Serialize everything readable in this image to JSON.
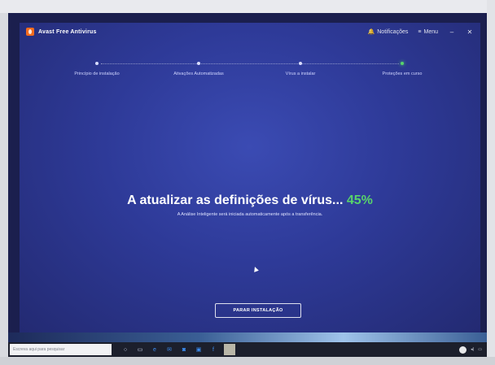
{
  "app": {
    "title": "Avast Free Antivirus",
    "notifications_label": "Notificações",
    "menu_label": "Menu",
    "minimize": "–",
    "close": "✕"
  },
  "steps": [
    {
      "label": "Princípio de instalação",
      "state": "done"
    },
    {
      "label": "Ativações Automatizadas",
      "state": "done"
    },
    {
      "label": "Vírus a instalar",
      "state": "done"
    },
    {
      "label": "Proteções em curso",
      "state": "active"
    }
  ],
  "status": {
    "text": "A atualizar as definições de vírus...",
    "percent": "45%",
    "progress_fraction": 0.45,
    "subtext": "A Análise Inteligente será iniciada automaticamente após a transferência."
  },
  "stop_button": "PARAR INSTALAÇÃO",
  "taskbar": {
    "search_placeholder": "Escreva aqui para pesquisar",
    "icons": [
      "cortana-icon",
      "task-view-icon",
      "edge-icon",
      "mail-icon",
      "camera-icon",
      "store-icon",
      "facebook-icon",
      "avast-icon"
    ]
  },
  "colors": {
    "accent_green": "#58d36b",
    "background_blue": "#2e3a98",
    "avast_orange": "#f36b1e"
  }
}
